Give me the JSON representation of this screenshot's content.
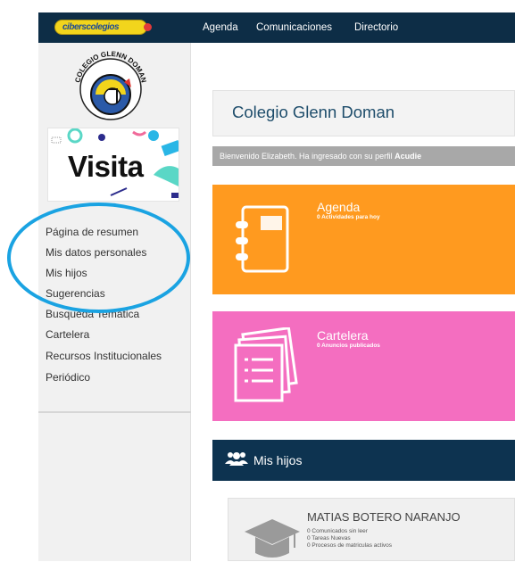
{
  "topbar": {
    "logo_text": "ciberscolegios",
    "nav": [
      "Agenda",
      "Comunicaciones",
      "Directorio"
    ]
  },
  "sidebar": {
    "school_logo_text": "COLEGIO GLENN DOMAN",
    "banner_text": "Visita",
    "items": [
      "Página de resumen",
      "Mis datos personales",
      "Mis hijos",
      "Sugerencias",
      "Busqueda Temática",
      "Cartelera",
      "Recursos Institucionales",
      "Periódico"
    ]
  },
  "main": {
    "school_title": "Colegio Glenn Doman",
    "welcome_prefix": "Bienvenido Elizabeth. Ha ingresado con su perfil ",
    "welcome_profile": "Acudie",
    "agenda": {
      "title": "Agenda",
      "subtitle": "0 Actividades para hoy",
      "color": "#ff9a1f"
    },
    "cartelera": {
      "title": "Cartelera",
      "subtitle": "0 Anuncios publicados",
      "color": "#f46ec0"
    },
    "hijos": {
      "title": "Mis hijos",
      "student_name": "MATIAS BOTERO NARANJO",
      "stats": [
        "0 Comunicados sin leer",
        "0 Tareas Nuevas",
        "0 Procesos de matriculas activos"
      ]
    }
  },
  "colors": {
    "topbar": "#0d2d46",
    "highlight_ring": "#1aa3e2",
    "hijos_bar": "#0d3350"
  }
}
